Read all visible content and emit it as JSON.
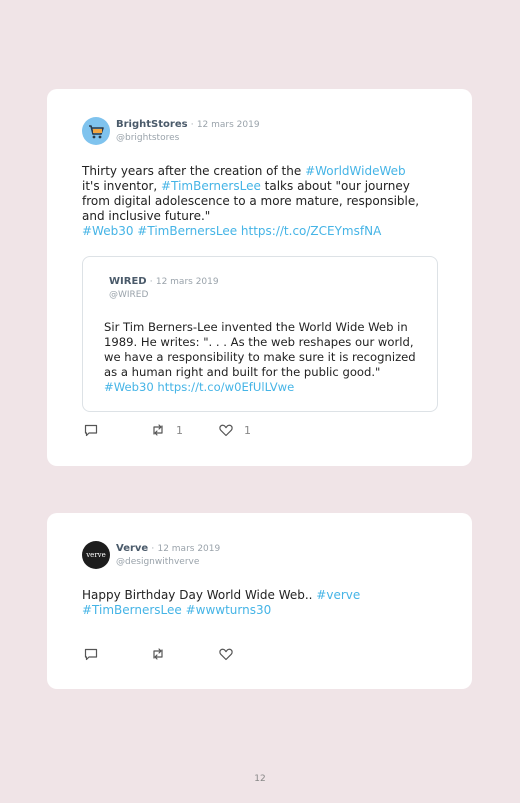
{
  "tweet1": {
    "author_name": "BrightStores",
    "separator": "·",
    "date": "12 mars 2019",
    "handle": "@brightstores",
    "text_parts": [
      {
        "text": "Thirty years after the creation of the ",
        "link": false
      },
      {
        "text": "#WorldWideWeb",
        "link": true
      },
      {
        "text": " it's inventor, ",
        "link": false
      },
      {
        "text": "#TimBernersLee",
        "link": true
      },
      {
        "text": " talks about \"our journey from digital adolescence to a more mature, responsible, and inclusive future.\"",
        "link": false
      },
      {
        "text": "\n",
        "link": false
      },
      {
        "text": "#Web30 #TimBernersLee https://t.co/ZCEYmsfNA",
        "link": true
      }
    ],
    "quote": {
      "author_name": "WIRED",
      "separator": "·",
      "date": "12 mars 2019",
      "handle": "@WIRED",
      "text_parts": [
        {
          "text": "Sir Tim Berners-Lee invented the World Wide Web in 1989. He writes: \". . . As the web reshapes our world, we have a responsibility to make sure it is recognized as a human right and built for the public good.\" ",
          "link": false
        },
        {
          "text": "#Web30 https://t.co/w0EfUlLVwe",
          "link": true
        }
      ]
    },
    "retweet_count": "1",
    "like_count": "1"
  },
  "tweet2": {
    "author_name": "Verve",
    "separator": "·",
    "date": "12 mars 2019",
    "handle": "@designwithverve",
    "avatar_text": "verve",
    "text_parts": [
      {
        "text": "Happy Birthday Day World Wide Web.. ",
        "link": false
      },
      {
        "text": "#verve",
        "link": true
      },
      {
        "text": "\n",
        "link": false
      },
      {
        "text": "#TimBernersLee #wwwturns30",
        "link": true
      }
    ],
    "retweet_count": "",
    "like_count": ""
  },
  "page_number": "12",
  "colors": {
    "background": "#f0e4e7",
    "link": "#45b4e6",
    "avatar1": "#7fc3ee"
  }
}
